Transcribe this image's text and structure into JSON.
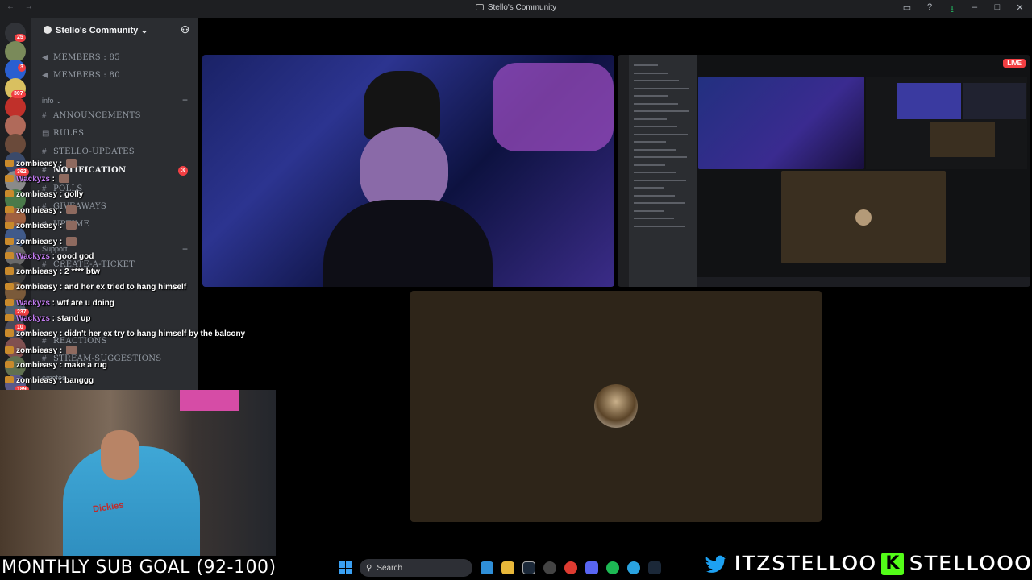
{
  "window": {
    "title": "Stello's Community",
    "nav": "← →"
  },
  "rail": {
    "badges": [
      "25",
      "3",
      "307"
    ],
    "colors": [
      "#5865f2",
      "#7a8a5a",
      "#2a5fd0",
      "#d9c060",
      "#c0302a",
      "#b06a5a",
      "#6a4a3a",
      "#3a4a6a",
      "#8a8a8a",
      "#4a7a4a",
      "#a06040",
      "#405a8a",
      "#6a6a6a",
      "#3a3a3a",
      "#7a5a3a",
      "#506070",
      "#4a4a5a",
      "#805050",
      "#607050",
      "#5a5a8a"
    ]
  },
  "sidebar": {
    "server_name": "Stello's Community",
    "voice_stats": [
      "MEMBERS : 85",
      "MEMBERS : 80"
    ],
    "category_info": "info",
    "channels": [
      "ANNOUNCEMENTS",
      "RULES",
      "STELLO-UPDATES",
      "NOTIFICATION",
      "POLLS",
      "GIVEAWAYS",
      "UPTIME"
    ],
    "notification_badge": "3",
    "category_support": "Support",
    "support_channels": [
      "CREATE-A-TICKET"
    ],
    "lower_channels": [
      "REACTIONS",
      "STREAM-SUGGESTIONS"
    ],
    "lower_category": "emotes"
  },
  "chat": [
    {
      "user": "zombieasy",
      "text": "",
      "emote": true,
      "color": "#ffffff",
      "count": "362"
    },
    {
      "user": "Wackyzs",
      "text": "",
      "emote": true,
      "color": "#c27bf0",
      "count": ""
    },
    {
      "user": "zombieasy",
      "text": "golly",
      "emote": false,
      "color": "#ffffff",
      "count": ""
    },
    {
      "user": "zombieasy",
      "text": "",
      "emote": true,
      "color": "#ffffff",
      "count": ""
    },
    {
      "user": "zombieasy",
      "text": "",
      "emote": true,
      "color": "#ffffff",
      "count": ""
    },
    {
      "user": "zombieasy",
      "text": "",
      "emote": true,
      "color": "#ffffff",
      "count": ""
    },
    {
      "user": "Wackyzs",
      "text": "good god",
      "emote": false,
      "color": "#c27bf0",
      "count": ""
    },
    {
      "user": "zombieasy",
      "text": "2 **** btw",
      "emote": false,
      "color": "#ffffff",
      "count": ""
    },
    {
      "user": "zombieasy",
      "text": "and her ex tried to hang himself",
      "emote": false,
      "color": "#ffffff",
      "count": ""
    },
    {
      "user": "Wackyzs",
      "text": "wtf are u doing",
      "emote": false,
      "color": "#c27bf0",
      "count": "237"
    },
    {
      "user": "Wackyzs",
      "text": "stand up",
      "emote": false,
      "color": "#c27bf0",
      "count": "10"
    },
    {
      "user": "zombieasy",
      "text": "didn't her ex try to hang himself by the balcony",
      "emote": false,
      "color": "#ffffff",
      "count": ""
    },
    {
      "user": "zombieasy",
      "text": "",
      "emote": true,
      "color": "#ffffff",
      "count": ""
    },
    {
      "user": "zombieasy",
      "text": "make a rug",
      "emote": false,
      "color": "#ffffff",
      "count": ""
    },
    {
      "user": "zombieasy",
      "text": "banggg",
      "emote": false,
      "color": "#ffffff",
      "count": "189"
    }
  ],
  "call": {
    "live_label": "LIVE"
  },
  "webcam": {
    "shirt_text": "Dickies"
  },
  "overlay": {
    "sub_goal": "MONTHLY SUB GOAL (92-100)",
    "twitter": "ITZSTELLOO",
    "kick_letter": "K",
    "kick": "STELLOOO"
  },
  "taskbar": {
    "search_placeholder": "Search"
  },
  "colors": {
    "discord_dark": "#1e1f22",
    "sidebar": "#2b2d31",
    "danger": "#f23f43",
    "kick_green": "#53fc18",
    "twitter_blue": "#1da1f2"
  }
}
